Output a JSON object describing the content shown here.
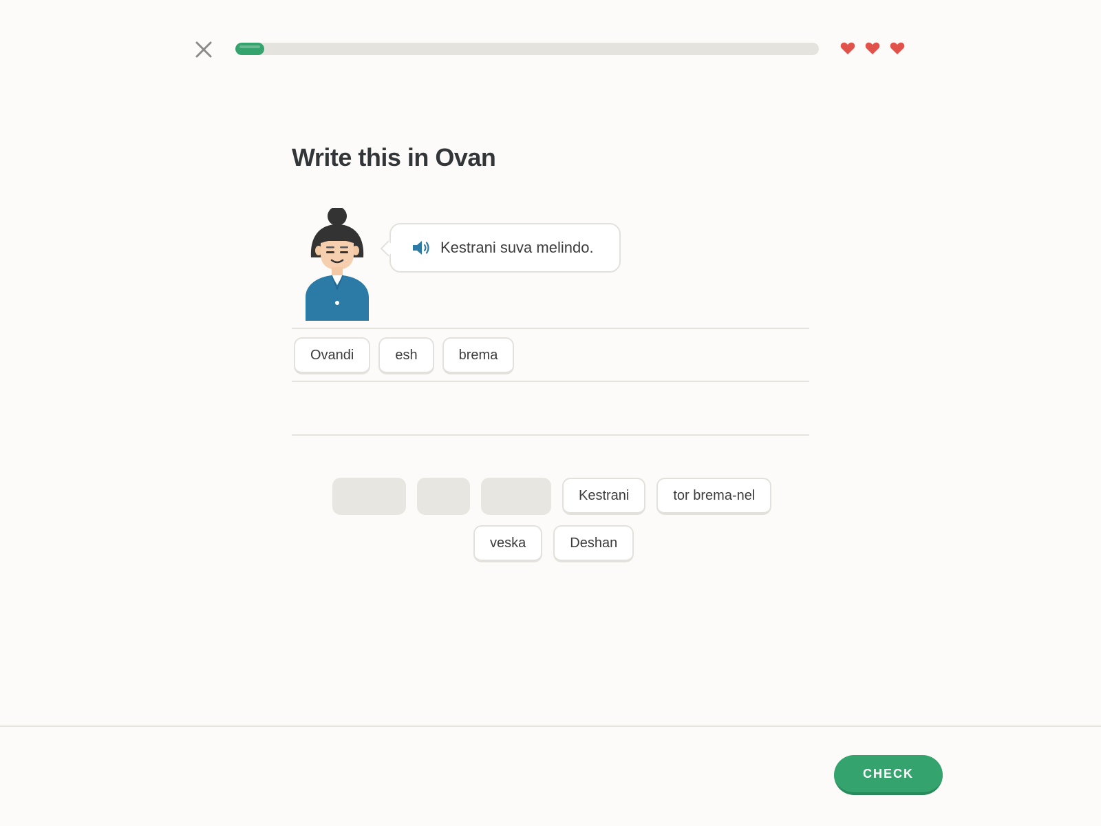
{
  "progress": {
    "fraction": 0.05
  },
  "hearts": {
    "count": 3,
    "color": "#E0524A"
  },
  "prompt": {
    "title": "Write this in Ovan",
    "sentence": "Kestrani suva melindo."
  },
  "answer": {
    "words": [
      "Ovandi",
      "esh",
      "brema"
    ]
  },
  "word_bank": {
    "row1_words": [
      "Kestrani",
      "tor brema-nel"
    ],
    "row2_words": [
      "veska",
      "Deshan"
    ]
  },
  "footer": {
    "check_label": "CHECK"
  },
  "colors": {
    "accent": "#34A36E",
    "heart": "#E0524A",
    "character_shirt": "#2B7BA6"
  },
  "icons": {
    "close": "close-icon",
    "heart": "heart-icon",
    "speaker": "speaker-icon"
  }
}
